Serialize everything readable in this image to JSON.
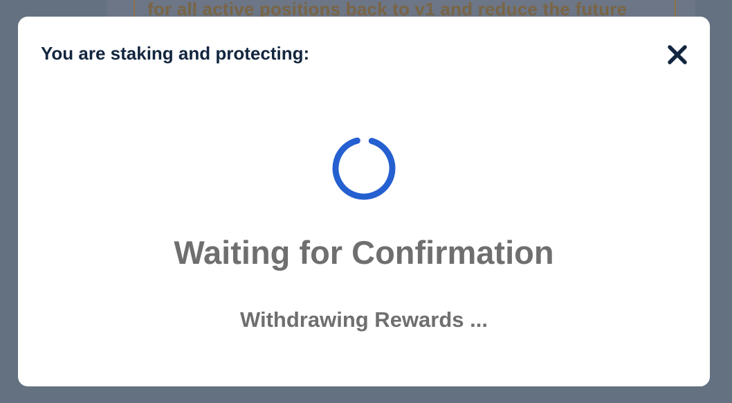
{
  "background": {
    "banner_text": "for all active positions back to v1 and reduce the future"
  },
  "modal": {
    "title": "You are staking and protecting:",
    "close_icon": "close-icon",
    "spinner_icon": "loading-spinner-icon",
    "status_title": "Waiting for Confirmation",
    "status_subtitle": "Withdrawing Rewards ..."
  },
  "colors": {
    "overlay": "#647181",
    "modal_bg": "#ffffff",
    "title_text": "#13263f",
    "status_text": "#6f6f6f",
    "spinner": "#2560d1"
  }
}
